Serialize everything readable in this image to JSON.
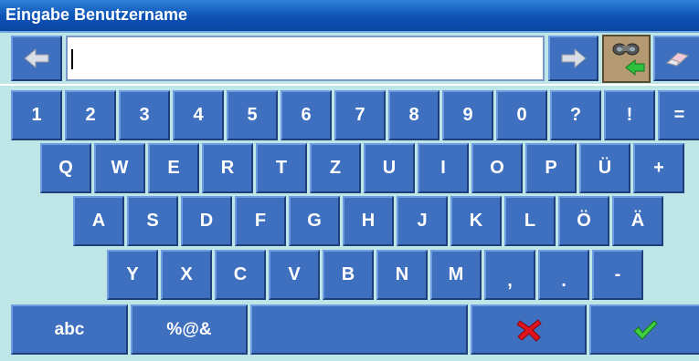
{
  "title": "Eingabe Benutzername",
  "input": {
    "value": ""
  },
  "icons": {
    "left_arrow": "arrow-left-icon",
    "right_arrow": "arrow-right-icon",
    "binoculars": "binoculars-search-icon",
    "eraser": "eraser-icon",
    "cancel": "red-x-icon",
    "ok": "green-check-icon"
  },
  "rows": {
    "row1": [
      "1",
      "2",
      "3",
      "4",
      "5",
      "6",
      "7",
      "8",
      "9",
      "0",
      "?",
      "!",
      "="
    ],
    "row2": [
      "Q",
      "W",
      "E",
      "R",
      "T",
      "Z",
      "U",
      "I",
      "O",
      "P",
      "Ü",
      "+"
    ],
    "row3": [
      "A",
      "S",
      "D",
      "F",
      "G",
      "H",
      "J",
      "K",
      "L",
      "Ö",
      "Ä"
    ],
    "row4": [
      "Y",
      "X",
      "C",
      "V",
      "B",
      "N",
      "M",
      ",",
      ".",
      "-"
    ]
  },
  "bottom": {
    "abc": "abc",
    "symbols": "%@&",
    "space": ""
  },
  "colors": {
    "key": "#3f6fbf",
    "title": "#0d52b5",
    "background": "#bfe6e6"
  }
}
